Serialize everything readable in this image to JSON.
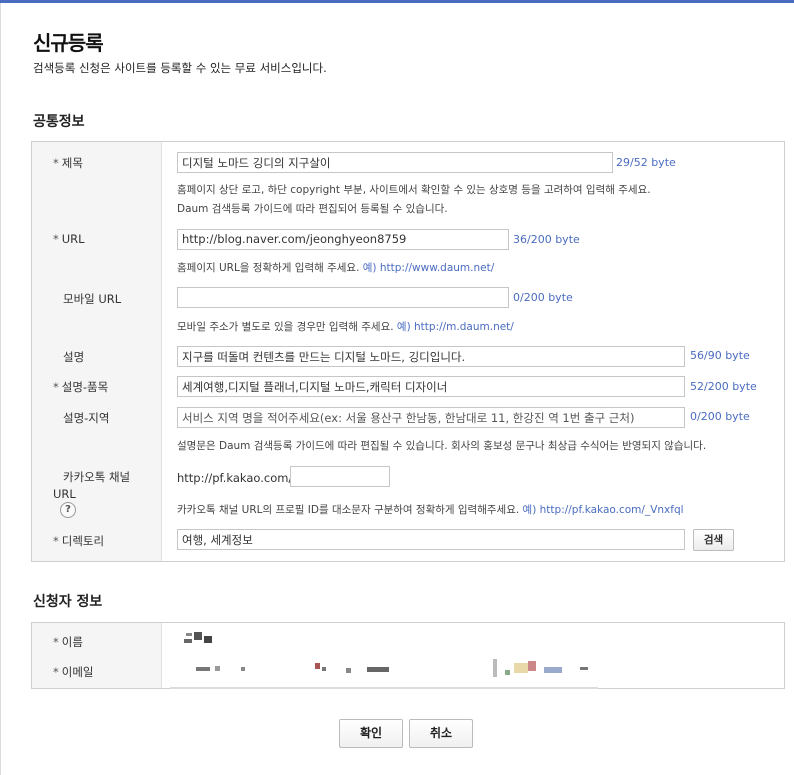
{
  "header": {
    "title": "신규등록",
    "subtitle": "검색등록 신청은 사이트를 등록할 수 있는 무료 서비스입니다."
  },
  "common": {
    "section_title": "공통정보",
    "fields": {
      "title": {
        "label": "제목",
        "value": "디지털 노마드 깅디의 지구살이",
        "count": "29/52 byte",
        "help1": "홈페이지 상단 로고, 하단 copyright 부분, 사이트에서 확인할 수 있는 상호명 등을 고려하여 입력해 주세요.",
        "help2": "Daum 검색등록 가이드에 따라 편집되어 등록될 수 있습니다."
      },
      "url": {
        "label": "URL",
        "value": "http://blog.naver.com/jeonghyeon8759",
        "count": "36/200 byte",
        "help": "홈페이지 URL을 정확하게 입력해 주세요.",
        "example": "예) http://www.daum.net/"
      },
      "mobile_url": {
        "label": "모바일 URL",
        "value": "",
        "count": "0/200 byte",
        "help": "모바일 주소가 별도로 있을 경우만 입력해 주세요.",
        "example": "예) http://m.daum.net/"
      },
      "desc": {
        "label": "설명",
        "value": "지구를 떠돌며 컨텐츠를 만드는 디지털 노마드, 깅디입니다.",
        "count": "56/90 byte"
      },
      "desc_item": {
        "label": "설명-품목",
        "value": "세계여행,디지털 플래너,디지털 노마드,캐릭터 디자이너",
        "count": "52/200 byte"
      },
      "desc_region": {
        "label": "설명-지역",
        "placeholder": "서비스 지역 명을 적어주세요(ex: 서울  용산구 한남동, 한남대로 11, 한강진 역 1번 출구 근처)",
        "count": "0/200 byte",
        "help": "설명문은 Daum 검색등록 가이드에 따라 편집될 수 있습니다. 회사의 홍보성 문구나 최상급 수식어는 반영되지 않습니다."
      },
      "kakao": {
        "label_line1": "카카오톡 채널",
        "label_line2": "URL",
        "question": "?",
        "prefix": "http://pf.kakao.com/",
        "value": "",
        "help": "카카오톡 채널 URL의 프로필 ID를 대소문자 구분하여 정확하게 입력해주세요.",
        "example": "예) http://pf.kakao.com/_Vnxfql"
      },
      "directory": {
        "label": "디렉토리",
        "value": "여행, 세계정보",
        "button": "검색"
      }
    },
    "required_mark": "*"
  },
  "applicant": {
    "section_title": "신청자 정보",
    "name_label": "이름",
    "email_label": "이메일"
  },
  "actions": {
    "confirm": "확인",
    "cancel": "취소"
  },
  "colors": {
    "accent": "#4a6cc0",
    "label_bg": "#f5f5f5"
  }
}
